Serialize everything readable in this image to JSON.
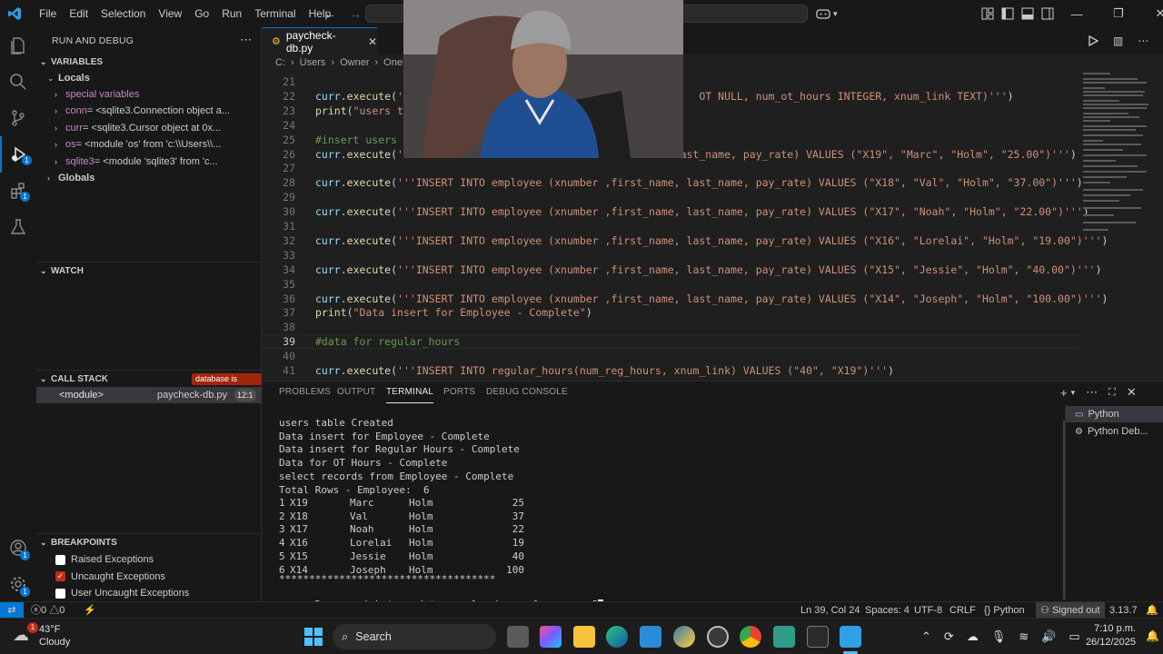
{
  "menu": [
    "File",
    "Edit",
    "Selection",
    "View",
    "Go",
    "Run",
    "Terminal",
    "Help"
  ],
  "sidebar": {
    "title": "RUN AND DEBUG",
    "variables_header": "VARIABLES",
    "locals_label": "Locals",
    "variables": [
      {
        "name": "special variables",
        "value": ""
      },
      {
        "name": "conn",
        "value": " = <sqlite3.Connection object a..."
      },
      {
        "name": "curr",
        "value": " = <sqlite3.Cursor object at 0x..."
      },
      {
        "name": "os",
        "value": " = <module 'os' from 'c:\\\\Users\\\\..."
      },
      {
        "name": "sqlite3",
        "value": " = <module 'sqlite3' from 'c..."
      }
    ],
    "globals_label": "Globals",
    "watch_header": "WATCH",
    "callstack_header": "CALL STACK",
    "callstack_badge": "database is locked",
    "callstack_frame": {
      "name": "<module>",
      "file": "paycheck-db.py",
      "pos": "12:1"
    },
    "breakpoints_header": "BREAKPOINTS",
    "breakpoints": [
      {
        "label": "Raised Exceptions",
        "checked": false
      },
      {
        "label": "Uncaught Exceptions",
        "checked": true
      },
      {
        "label": "User Uncaught Exceptions",
        "checked": false
      }
    ]
  },
  "editor": {
    "tab_label": "paycheck-db.py",
    "breadcrumb": [
      "C:",
      "Users",
      "Owner",
      "OneDri"
    ],
    "lines": [
      {
        "n": "21",
        "segs": []
      },
      {
        "n": "22",
        "segs": [
          {
            "c": "kw",
            "t": "curr"
          },
          {
            "c": "plain",
            "t": "."
          },
          {
            "c": "fn",
            "t": "execute"
          },
          {
            "c": "plain",
            "t": "("
          },
          {
            "c": "str",
            "t": "'''                                             OT NULL, num_ot_hours INTEGER, xnum_link TEXT)'''"
          },
          {
            "c": "plain",
            "t": ")"
          }
        ]
      },
      {
        "n": "23",
        "segs": [
          {
            "c": "fn",
            "t": "print"
          },
          {
            "c": "plain",
            "t": "("
          },
          {
            "c": "str",
            "t": "\"users ta"
          }
        ]
      },
      {
        "n": "24",
        "segs": []
      },
      {
        "n": "25",
        "segs": [
          {
            "c": "cmt",
            "t": "#insert users"
          }
        ]
      },
      {
        "n": "26",
        "segs": [
          {
            "c": "kw",
            "t": "curr"
          },
          {
            "c": "plain",
            "t": "."
          },
          {
            "c": "fn",
            "t": "execute"
          },
          {
            "c": "plain",
            "t": "("
          },
          {
            "c": "str",
            "t": "'''                                          ast_name, pay_rate) VALUES (\"X19\", \"Marc\", \"Holm\", \"25.00\")'''"
          },
          {
            "c": "plain",
            "t": ")"
          }
        ]
      },
      {
        "n": "27",
        "segs": []
      },
      {
        "n": "28",
        "segs": [
          {
            "c": "kw",
            "t": "curr"
          },
          {
            "c": "plain",
            "t": "."
          },
          {
            "c": "fn",
            "t": "execute"
          },
          {
            "c": "plain",
            "t": "("
          },
          {
            "c": "str",
            "t": "'''INSERT INTO employee (xnumber ,first_name, last_name, pay_rate) VALUES (\"X18\", \"Val\", \"Holm\", \"37.00\")'''"
          },
          {
            "c": "plain",
            "t": ")"
          }
        ]
      },
      {
        "n": "29",
        "segs": []
      },
      {
        "n": "30",
        "segs": [
          {
            "c": "kw",
            "t": "curr"
          },
          {
            "c": "plain",
            "t": "."
          },
          {
            "c": "fn",
            "t": "execute"
          },
          {
            "c": "plain",
            "t": "("
          },
          {
            "c": "str",
            "t": "'''INSERT INTO employee (xnumber ,first_name, last_name, pay_rate) VALUES (\"X17\", \"Noah\", \"Holm\", \"22.00\")'''"
          },
          {
            "c": "plain",
            "t": ")"
          }
        ]
      },
      {
        "n": "31",
        "segs": []
      },
      {
        "n": "32",
        "segs": [
          {
            "c": "kw",
            "t": "curr"
          },
          {
            "c": "plain",
            "t": "."
          },
          {
            "c": "fn",
            "t": "execute"
          },
          {
            "c": "plain",
            "t": "("
          },
          {
            "c": "str",
            "t": "'''INSERT INTO employee (xnumber ,first_name, last_name, pay_rate) VALUES (\"X16\", \"Lorelai\", \"Holm\", \"19.00\")'''"
          },
          {
            "c": "plain",
            "t": ")"
          }
        ]
      },
      {
        "n": "33",
        "segs": []
      },
      {
        "n": "34",
        "segs": [
          {
            "c": "kw",
            "t": "curr"
          },
          {
            "c": "plain",
            "t": "."
          },
          {
            "c": "fn",
            "t": "execute"
          },
          {
            "c": "plain",
            "t": "("
          },
          {
            "c": "str",
            "t": "'''INSERT INTO employee (xnumber ,first_name, last_name, pay_rate) VALUES (\"X15\", \"Jessie\", \"Holm\", \"40.00\")'''"
          },
          {
            "c": "plain",
            "t": ")"
          }
        ]
      },
      {
        "n": "35",
        "segs": []
      },
      {
        "n": "36",
        "segs": [
          {
            "c": "kw",
            "t": "curr"
          },
          {
            "c": "plain",
            "t": "."
          },
          {
            "c": "fn",
            "t": "execute"
          },
          {
            "c": "plain",
            "t": "("
          },
          {
            "c": "str",
            "t": "'''INSERT INTO employee (xnumber ,first_name, last_name, pay_rate) VALUES (\"X14\", \"Joseph\", \"Holm\", \"100.00\")'''"
          },
          {
            "c": "plain",
            "t": ")"
          }
        ]
      },
      {
        "n": "37",
        "segs": [
          {
            "c": "fn",
            "t": "print"
          },
          {
            "c": "plain",
            "t": "("
          },
          {
            "c": "str",
            "t": "\"Data insert for Employee - Complete\""
          },
          {
            "c": "plain",
            "t": ")"
          }
        ]
      },
      {
        "n": "38",
        "segs": []
      },
      {
        "n": "39",
        "segs": [
          {
            "c": "cmt",
            "t": "#data for regular_hours"
          }
        ]
      },
      {
        "n": "40",
        "segs": []
      },
      {
        "n": "41",
        "segs": [
          {
            "c": "kw",
            "t": "curr"
          },
          {
            "c": "plain",
            "t": "."
          },
          {
            "c": "fn",
            "t": "execute"
          },
          {
            "c": "plain",
            "t": "("
          },
          {
            "c": "str",
            "t": "'''INSERT INTO regular_hours(num_reg_hours, xnum_link) VALUES (\"40\", \"X19\")'''"
          },
          {
            "c": "plain",
            "t": ")"
          }
        ]
      }
    ]
  },
  "panel": {
    "tabs": [
      "PROBLEMS",
      "OUTPUT",
      "TERMINAL",
      "PORTS",
      "DEBUG CONSOLE"
    ],
    "active_tab": "TERMINAL",
    "terminal_lines": [
      "users table Created",
      "Data insert for Employee - Complete",
      "Data insert for Regular Hours - Complete",
      "Data for OT Hours - Complete",
      "select records from Employee - Complete",
      "Total Rows - Employee:  6"
    ],
    "employee_rows": [
      [
        "1",
        "X19",
        "Marc",
        "Holm",
        "25"
      ],
      [
        "2",
        "X18",
        "Val",
        "Holm",
        "37"
      ],
      [
        "3",
        "X17",
        "Noah",
        "Holm",
        "22"
      ],
      [
        "4",
        "X16",
        "Lorelai",
        "Holm",
        "19"
      ],
      [
        "5",
        "X15",
        "Jessie",
        "Holm",
        "40"
      ],
      [
        "6",
        "X14",
        "Joseph",
        "Holm",
        "100"
      ]
    ],
    "separator": "************************************",
    "prompt": "Do you wish to update regular hours for a user?",
    "terminals": [
      "Python",
      "Python Deb..."
    ]
  },
  "statusbar": {
    "errors": "0",
    "warnings": "0",
    "position": "Ln 39, Col 24",
    "spaces": "Spaces: 4",
    "encoding": "UTF-8",
    "eol": "CRLF",
    "language": "Python",
    "account": "Signed out",
    "version": "3.13.7"
  },
  "taskbar": {
    "weather_temp": "43°F",
    "weather_desc": "Cloudy",
    "weather_badge": "1",
    "search_placeholder": "Search",
    "time": "7:10 p.m.",
    "date": "26/12/2025"
  },
  "colors": {
    "accent": "#0078d4",
    "editor_bg": "#1f1f1f",
    "sidebar_bg": "#181818",
    "callstack_badge_bg": "#a1260d"
  }
}
